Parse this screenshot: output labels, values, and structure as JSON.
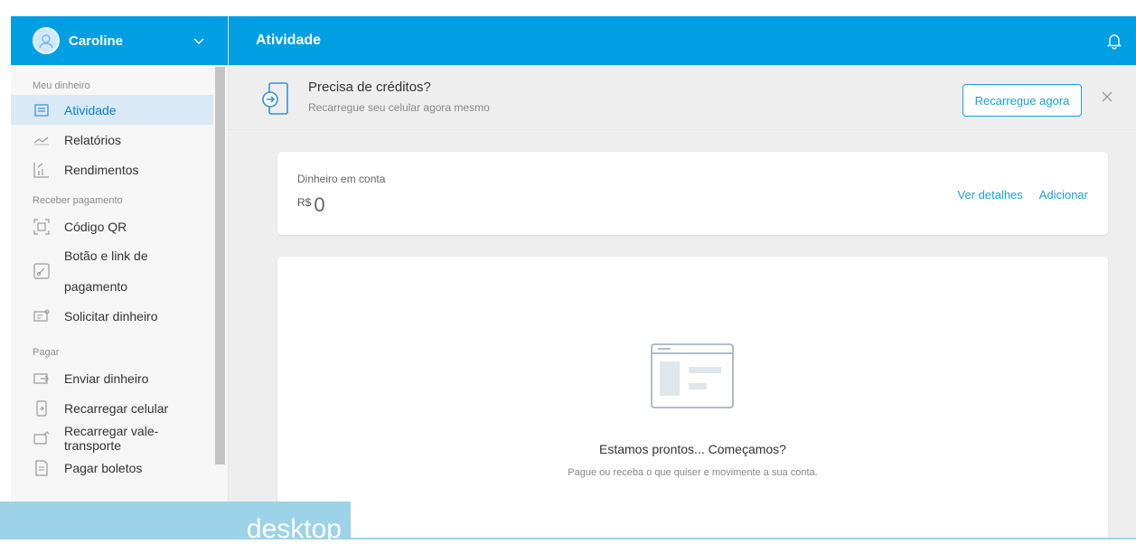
{
  "user": {
    "name": "Caroline"
  },
  "header": {
    "title": "Atividade"
  },
  "sidebar": {
    "sections": [
      {
        "title": "Meu dinheiro",
        "items": [
          {
            "label": "Atividade",
            "icon": "activity-icon",
            "active": true
          },
          {
            "label": "Relatórios",
            "icon": "chart-line-icon"
          },
          {
            "label": "Rendimentos",
            "icon": "bar-chart-icon"
          }
        ]
      },
      {
        "title": "Receber pagamento",
        "items": [
          {
            "label": "Código QR",
            "icon": "qr-code-icon"
          },
          {
            "label_line1": "Botão e link de",
            "label_line2": "pagamento",
            "icon": "link-icon"
          },
          {
            "label": "Solicitar dinheiro",
            "icon": "request-money-icon"
          }
        ]
      },
      {
        "title": "Pagar",
        "items": [
          {
            "label": "Enviar dinheiro",
            "icon": "send-money-icon"
          },
          {
            "label": "Recarregar celular",
            "icon": "phone-icon"
          },
          {
            "label": "Recarregar vale-transporte",
            "icon": "card-icon"
          },
          {
            "label": "Pagar boletos",
            "icon": "bill-icon"
          }
        ]
      }
    ]
  },
  "promo": {
    "title": "Precisa de créditos?",
    "subtitle": "Recarregue seu celular agora mesmo",
    "button": "Recarregue agora"
  },
  "balance": {
    "label": "Dinheiro em conta",
    "currency": "R$",
    "value": "0",
    "details_link": "Ver detalhes",
    "add_link": "Adicionar"
  },
  "empty_state": {
    "title": "Estamos prontos... Começamos?",
    "text": "Pague ou receba o que quiser e movimente a sua conta."
  },
  "watermark": {
    "label": "desktop"
  },
  "colors": {
    "brand": "#009ee3",
    "link": "#1a9fe0",
    "active_bg": "#d9e9f5"
  }
}
